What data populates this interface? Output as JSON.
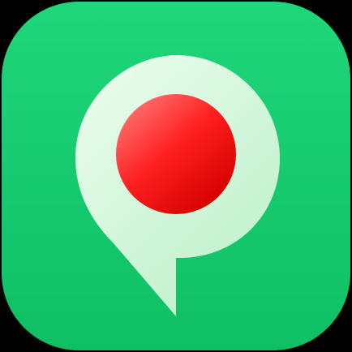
{
  "icon": {
    "name": "location-pin-record-app-icon",
    "colors": {
      "background": "#000000",
      "tile_top": "#1fd67b",
      "tile_bottom": "#0fbf63",
      "pin_light": "#e6fbe9",
      "pin_shade": "#bff1cc",
      "dot_highlight": "#ff6b6b",
      "dot_core": "#ff1f1f",
      "dot_shadow": "#d40000"
    }
  }
}
